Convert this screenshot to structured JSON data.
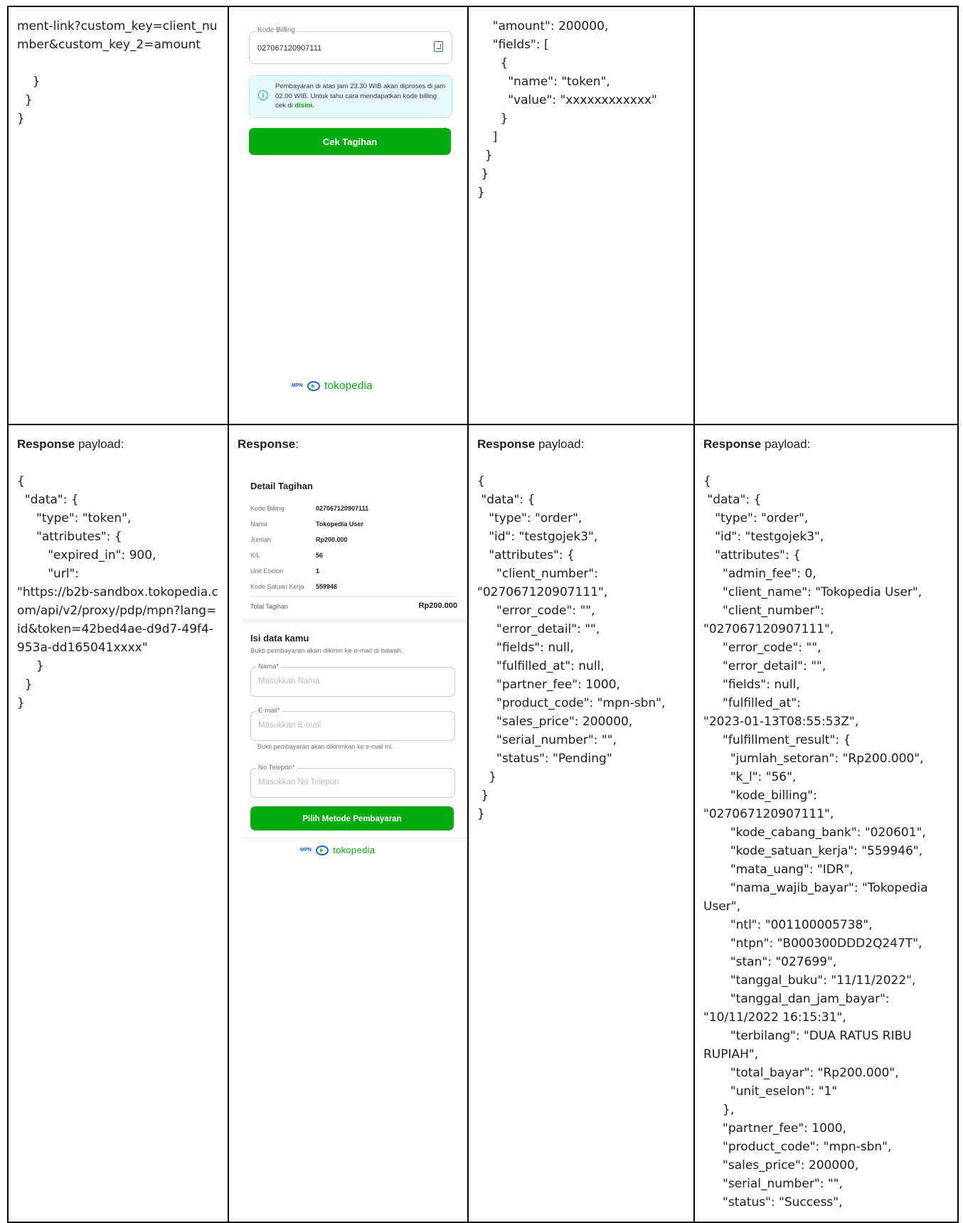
{
  "cell_top_left_code": "ment-link?custom_key=client_number&custom_key_2=amount\n\n    }\n  }\n}",
  "phone_top": {
    "billing_label": "Kode Billing",
    "billing_value": "027067120907111",
    "info_text": "Pembayaran di atas jam 23.30 WIB akan diproses di jam 02.00 WIB. Untuk tahu cara mendapatkan kode billing cek di ",
    "info_link": "disini.",
    "button": "Cek Tagihan",
    "logo_mpn": "MPN",
    "logo_brand": "tokopedia"
  },
  "cell_top_third_code": "    \"amount\": 200000,\n    \"fields\": [\n      {\n        \"name\": \"token\",\n        \"value\": \"xxxxxxxxxxxx\"\n      }\n    ]\n  }\n }\n}",
  "resp1": {
    "heading_bold": "Response",
    "heading_rest": " payload:",
    "code": "{\n  \"data\": {\n     \"type\": \"token\",\n     \"attributes\": {\n        \"expired_in\": 900,\n        \"url\":\n\"https://b2b-sandbox.tokopedia.com/api/v2/proxy/pdp/mpn?lang=id&token=42bed4ae-d9d7-49f4-953a-dd165041xxxx\"\n     }\n  }\n}"
  },
  "resp2": {
    "heading_bold": "Response",
    "heading_rest": ":",
    "detail_title": "Detail Tagihan",
    "rows": [
      {
        "k": "Kode Billing",
        "v": "027067120907111"
      },
      {
        "k": "Nama",
        "v": "Tokopedia User"
      },
      {
        "k": "Jumlah",
        "v": "Rp200.000"
      },
      {
        "k": "K/L",
        "v": "56"
      },
      {
        "k": "Unit Eselon",
        "v": "1"
      },
      {
        "k": "Kode Satuan Kerja",
        "v": "559946"
      }
    ],
    "total_label": "Total Tagihan",
    "total_value": "Rp200.000",
    "isi_title": "Isi data kamu",
    "isi_sub": "Bukti pembayaran akan dikirim ke e-mail di bawah.",
    "nama_label": "Nama*",
    "nama_ph": "Masukkan Nama",
    "email_label": "E-mail*",
    "email_ph": "Masukkan E-mail",
    "email_hint": "Bukti pembayaran akan dikirimkan ke e-mail ini.",
    "telp_label": "No Telepon*",
    "telp_ph": "Masukkan No Telepon",
    "button": "Pilih Metode Pembayaran",
    "logo_mpn": "MPN",
    "logo_brand": "tokopedia"
  },
  "resp3": {
    "heading_bold": "Response",
    "heading_rest": " payload:",
    "code": "{\n \"data\": {\n   \"type\": \"order\",\n   \"id\": \"testgojek3\",\n   \"attributes\": {\n     \"client_number\":\n\"027067120907111\",\n     \"error_code\": \"\",\n     \"error_detail\": \"\",\n     \"fields\": null,\n     \"fulfilled_at\": null,\n     \"partner_fee\": 1000,\n     \"product_code\": \"mpn-sbn\",\n     \"sales_price\": 200000,\n     \"serial_number\": \"\",\n     \"status\": \"Pending\"\n   }\n }\n}"
  },
  "resp4": {
    "heading_bold": "Response",
    "heading_rest": " payload:",
    "code": "{\n \"data\": {\n   \"type\": \"order\",\n   \"id\": \"testgojek3\",\n   \"attributes\": {\n     \"admin_fee\": 0,\n     \"client_name\": \"Tokopedia User\",\n     \"client_number\":\n\"027067120907111\",\n     \"error_code\": \"\",\n     \"error_detail\": \"\",\n     \"fields\": null,\n     \"fulfilled_at\":\n\"2023-01-13T08:55:53Z\",\n     \"fulfillment_result\": {\n       \"jumlah_setoran\": \"Rp200.000\",\n       \"k_l\": \"56\",\n       \"kode_billing\":\n\"027067120907111\",\n       \"kode_cabang_bank\": \"020601\",\n       \"kode_satuan_kerja\": \"559946\",\n       \"mata_uang\": \"IDR\",\n       \"nama_wajib_bayar\": \"Tokopedia User\",\n       \"ntl\": \"001100005738\",\n       \"ntpn\": \"B000300DDD2Q247T\",\n       \"stan\": \"027699\",\n       \"tanggal_buku\": \"11/11/2022\",\n       \"tanggal_dan_jam_bayar\":\n\"10/11/2022 16:15:31\",\n       \"terbilang\": \"DUA RATUS RIBU RUPIAH\",\n       \"total_bayar\": \"Rp200.000\",\n       \"unit_eselon\": \"1\"\n     },\n     \"partner_fee\": 1000,\n     \"product_code\": \"mpn-sbn\",\n     \"sales_price\": 200000,\n     \"serial_number\": \"\",\n     \"status\": \"Success\","
  }
}
